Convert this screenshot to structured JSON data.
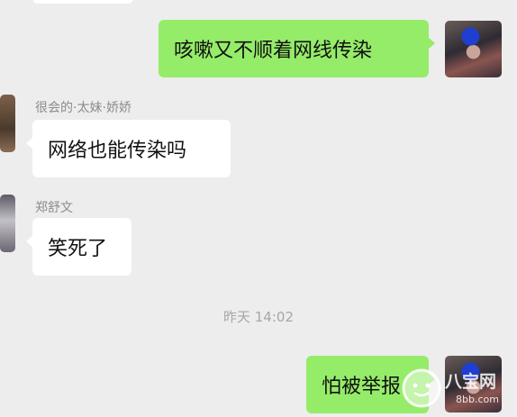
{
  "messages": [
    {
      "side": "right",
      "text": "咳嗽又不顺着网线传染"
    },
    {
      "side": "left",
      "sender": "很会的·太妹·娇娇",
      "text": "网络也能传染吗"
    },
    {
      "side": "left",
      "sender": "郑舒文",
      "text": "笑死了"
    },
    {
      "side": "right",
      "text": "怕被举报"
    }
  ],
  "timestamp": "昨天 14:02",
  "watermark": {
    "brand": "八宝网",
    "url": "8bb.com"
  },
  "colors": {
    "background": "#ededed",
    "right_bubble": "#95ec69",
    "left_bubble": "#ffffff"
  }
}
